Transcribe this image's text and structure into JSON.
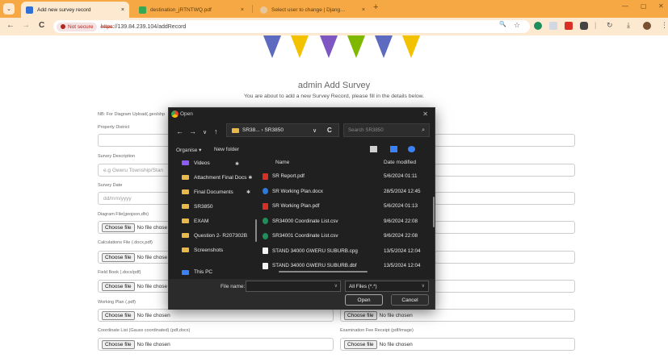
{
  "browser": {
    "tabs": [
      {
        "title": "Add new survey record",
        "close": "×",
        "active": true
      },
      {
        "title": "destination_jRTNTWQ.pdf",
        "close": "×",
        "active": false
      },
      {
        "title": "Select user to change | Djang…",
        "close": "×",
        "active": false
      }
    ],
    "new_tab": "+",
    "window_controls": {
      "minimize": "—",
      "maximize": "▢",
      "close": "✕"
    },
    "dropdown": "⌄",
    "nav": {
      "back": "←",
      "forward": "→",
      "reload": "C"
    },
    "security_chip": "Not secure",
    "url_proto": "https",
    "url_rest": "://139.84.239.104/addRecord",
    "toolbar_glyphs": {
      "zoom": "🔍",
      "star": "☆",
      "divider": "|",
      "sync": "↻",
      "download": "⤓",
      "menu": "⋮"
    }
  },
  "page": {
    "title": "admin Add Survey",
    "subtitle": "You are about to add a new Survey Record, please fill in the details below.",
    "note": "NB: For Diagram Upload(.geo/shp",
    "fields": {
      "property_district": {
        "label": "Property District"
      },
      "survey_description": {
        "label": "Survey Description",
        "placeholder": "e.g Gweru Township/Stan"
      },
      "survey_date": {
        "label": "Survey Date",
        "placeholder": "dd/mm/yyyy"
      },
      "diagram_file": {
        "label": "Diagram File(geojson,dfx)",
        "button": "Choose file",
        "status": "No file chose"
      },
      "calculations_file": {
        "label": "Calculations File (.docx,pdf)",
        "button": "Choose file",
        "status": "No file chose"
      },
      "field_book": {
        "label": "Field Book (.docx/pdf)",
        "button": "Choose file",
        "status": "No file chose"
      },
      "working_plan": {
        "label": "Working Plan (.pdf)",
        "button": "Choose file",
        "status": "No file chosen"
      },
      "working_plan_right": {
        "button": "Choose file",
        "status": "No file chosen"
      },
      "coordinate_list": {
        "label": "Coordinate List (Gauss coordinated) (pdf,docx)",
        "button": "Choose file",
        "status": "No file chosen"
      },
      "examination_fee": {
        "label": "Examination Fee Receipt (pdf/image)",
        "button": "Choose file",
        "status": "No file chosen"
      }
    }
  },
  "dialog": {
    "title": "Open",
    "close": "✕",
    "nav": {
      "back": "←",
      "forward": "→",
      "recent": "∨",
      "up": "↑",
      "refresh": "C",
      "path_chev": "∨"
    },
    "path": "SR38... › SR3850",
    "search_placeholder": "Search SR3850",
    "search_glyph": "⌕",
    "commands": {
      "organise": "Organise ▾",
      "new_folder": "New folder"
    },
    "columns": {
      "name": "Name",
      "date": "Date modified"
    },
    "nav_pin": "✱",
    "nav_items": [
      "Videos",
      "Attachment Final Docs",
      "Final Documents",
      "SR3850",
      "EXAM",
      "Question 2- R207302B",
      "Screenshots",
      "This PC"
    ],
    "files": [
      {
        "name": "SR Report.pdf",
        "date": "5/6/2024 01:11",
        "kind": "pdf"
      },
      {
        "name": "SR Working Plan.docx",
        "date": "28/5/2024 12:45",
        "kind": "doc"
      },
      {
        "name": "SR Working Plan.pdf",
        "date": "5/6/2024 01:13",
        "kind": "pdf"
      },
      {
        "name": "SR34000 Coordinate List.csv",
        "date": "9/6/2024 22:08",
        "kind": "csv"
      },
      {
        "name": "SR34001 Coordinate List.csv",
        "date": "9/6/2024 22:08",
        "kind": "csv"
      },
      {
        "name": "STAND 34000 GWERU SUBURB.cpg",
        "date": "13/5/2024 12:04",
        "kind": "gen"
      },
      {
        "name": "STAND 34000 GWERU SUBURB.dbf",
        "date": "13/5/2024 12:04",
        "kind": "gen"
      }
    ],
    "file_name_label": "File name:",
    "file_name_value": "",
    "filter": "All Files (*.*)",
    "filter_chev": "∨",
    "open_label": "Open",
    "cancel_label": "Cancel",
    "colors": {
      "pdf": "#d93025",
      "doc": "#2b79d8",
      "csv": "#1e8e5a",
      "folder": "#e8b84a"
    }
  }
}
